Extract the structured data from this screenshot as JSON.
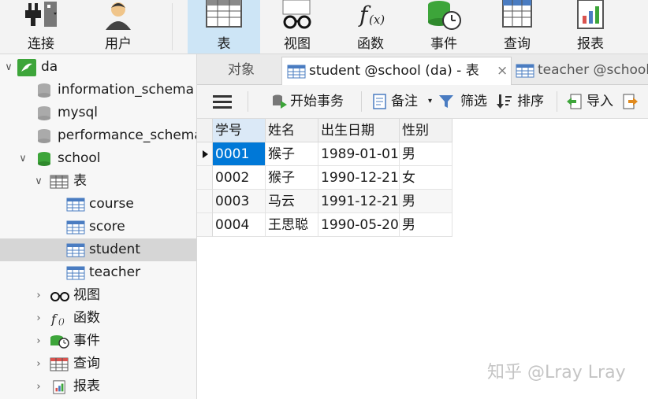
{
  "toolbar": {
    "connect": "连接",
    "user": "用户",
    "table": "表",
    "view": "视图",
    "function": "函数",
    "event": "事件",
    "query": "查询",
    "report": "报表"
  },
  "sidebar": {
    "connection": "da",
    "databases": [
      "information_schema",
      "mysql",
      "performance_schema",
      "school"
    ],
    "tables_group": "表",
    "tables": [
      "course",
      "score",
      "student",
      "teacher"
    ],
    "groups": [
      "视图",
      "函数",
      "事件",
      "查询",
      "报表"
    ]
  },
  "tabs": {
    "objects": "对象",
    "student_tab": "student @school (da) - 表",
    "close": "×",
    "teacher_tab": "teacher @school"
  },
  "subtoolbar": {
    "begin_transaction": "开始事务",
    "memo": "备注",
    "filter": "筛选",
    "sort": "排序",
    "import": "导入"
  },
  "grid": {
    "columns": [
      "学号",
      "姓名",
      "出生日期",
      "性别"
    ],
    "rows": [
      [
        "0001",
        "猴子",
        "1989-01-01",
        "男"
      ],
      [
        "0002",
        "猴子",
        "1990-12-21",
        "女"
      ],
      [
        "0003",
        "马云",
        "1991-12-21",
        "男"
      ],
      [
        "0004",
        "王思聪",
        "1990-05-20",
        "男"
      ]
    ]
  },
  "watermark": "知乎 @Lray Lray",
  "colors": {
    "accent": "#0078d7",
    "active_toolbar_bg": "#cde5f6",
    "db_green": "#3da53a"
  }
}
